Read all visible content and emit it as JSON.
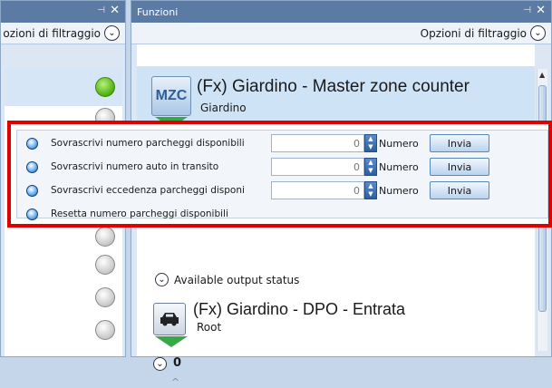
{
  "left_panel": {
    "pin_icon": "pin-icon",
    "close_label": "✕",
    "filter_label": "ozioni di filtraggio"
  },
  "right_panel": {
    "title": "Funzioni",
    "close_label": "✕",
    "filter_label": "Opzioni di filtraggio",
    "card1": {
      "icon_text": "MZC",
      "title": "(Fx) Giardino - Master zone counter",
      "subtitle": "Giardino"
    },
    "available_output_status": "Available output status",
    "card2": {
      "title": "(Fx) Giardino - DPO - Entrata",
      "subtitle": "Root",
      "value": "0"
    }
  },
  "popup": {
    "rows": [
      {
        "label": "Sovrascrivi numero parcheggi disponibili",
        "value": "0",
        "unit": "Numero",
        "button": "Invia"
      },
      {
        "label": "Sovrascrivi numero auto in transito",
        "value": "0",
        "unit": "Numero",
        "button": "Invia"
      },
      {
        "label": "Sovrascrivi eccedenza parcheggi disponi",
        "value": "0",
        "unit": "Numero",
        "button": "Invia"
      },
      {
        "label": "Resetta numero parcheggi disponibili"
      }
    ]
  },
  "colors": {
    "titlebar": "#5b7ba5",
    "highlight_border": "#e10000",
    "status_green": "#4caf10",
    "status_grey": "#c7c7c7"
  }
}
